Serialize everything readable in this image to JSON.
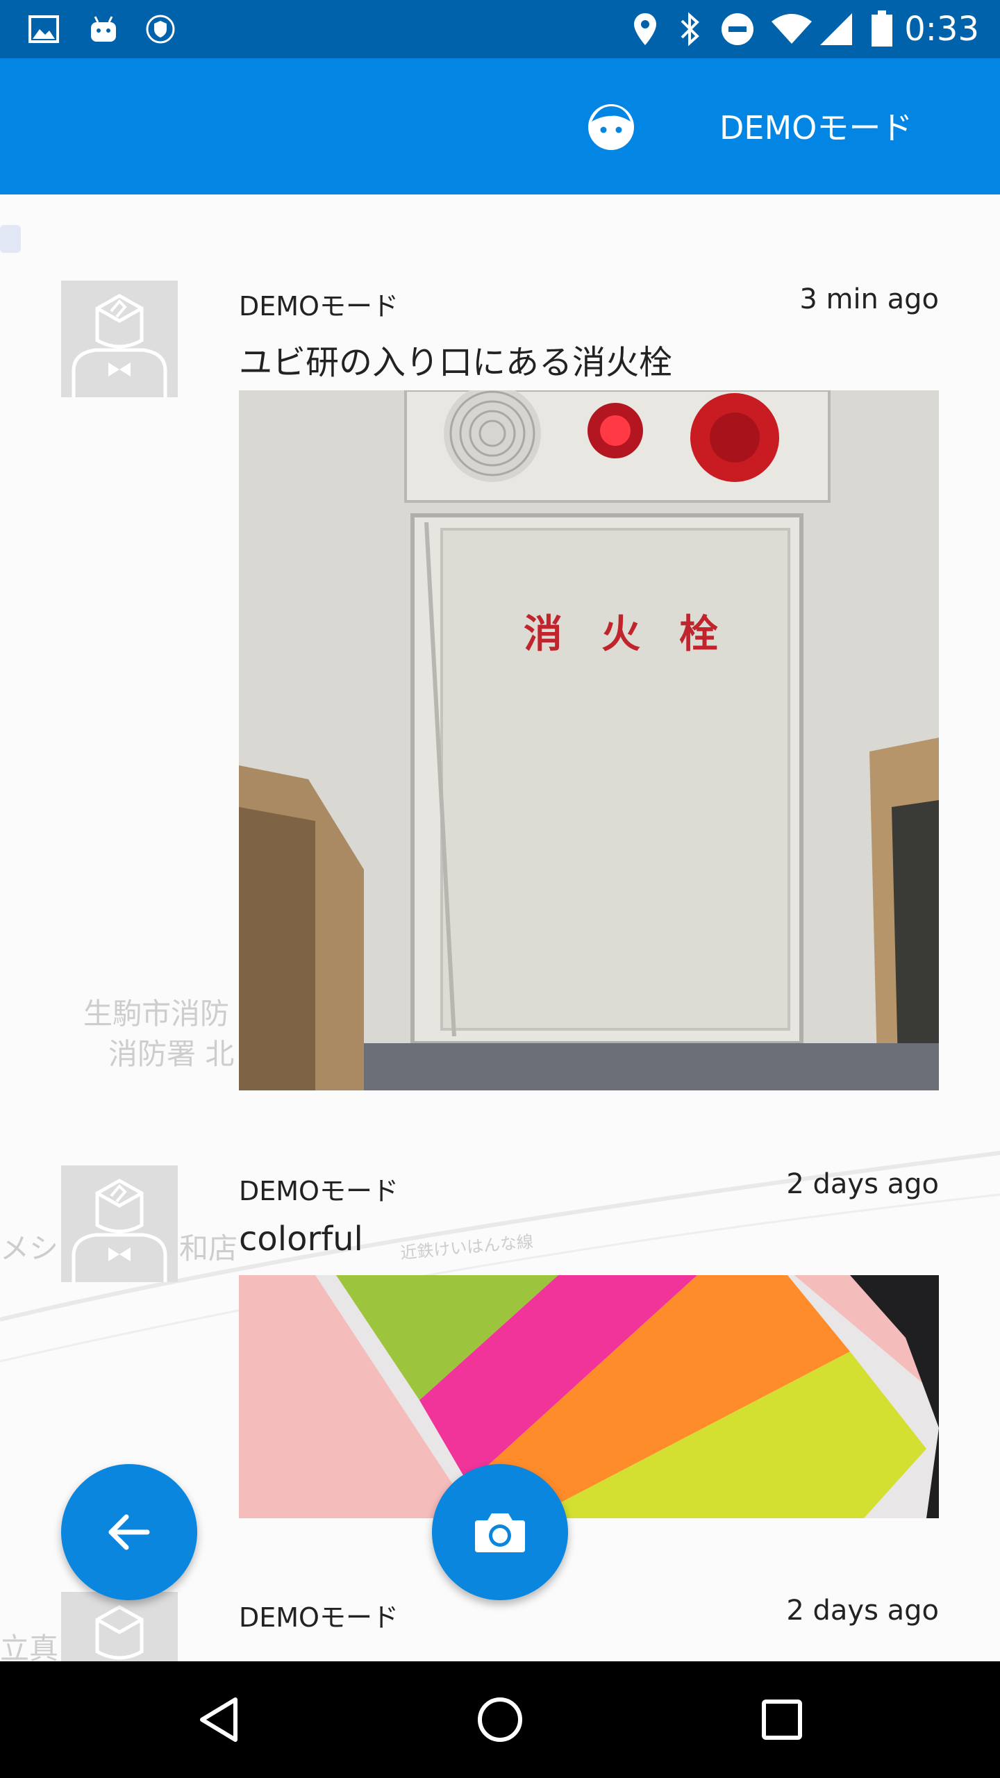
{
  "status_bar": {
    "time": "0:33",
    "icons": [
      "gallery-icon",
      "android-icon",
      "shield-icon",
      "location-icon",
      "bluetooth-icon",
      "do-not-disturb-icon",
      "wifi-icon",
      "signal-icon",
      "battery-icon"
    ]
  },
  "app_bar": {
    "mode_label": "DEMOモード",
    "face_icon": "face-icon",
    "color": "#0386e3"
  },
  "map_labels": [
    "生駒市消防",
    "消防署 北",
    "メシー",
    "和店",
    "近鉄けいはんな線",
    "立真"
  ],
  "posts": [
    {
      "user": "DEMOモード",
      "time": "3 min ago",
      "caption": "ユビ研の入り口にある消火栓",
      "photo_text": "消　火　栓"
    },
    {
      "user": "DEMOモード",
      "time": "2 days ago",
      "caption": "colorful"
    },
    {
      "user": "DEMOモード",
      "time": "2 days ago"
    }
  ],
  "fabs": {
    "back_icon": "arrow-left-icon",
    "camera_icon": "camera-icon",
    "accent": "#0a86df"
  },
  "nav_bar": {
    "icons": [
      "back-triangle-icon",
      "home-circle-icon",
      "recents-square-icon"
    ]
  }
}
